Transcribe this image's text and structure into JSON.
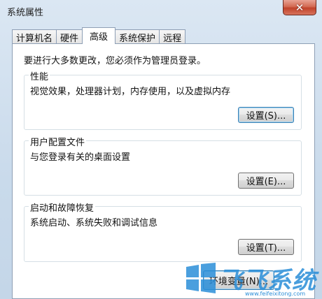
{
  "window": {
    "title": "系统属性",
    "close_glyph": "✕"
  },
  "tabs": [
    {
      "label": "计算机名",
      "active": false
    },
    {
      "label": "硬件",
      "active": false
    },
    {
      "label": "高级",
      "active": true
    },
    {
      "label": "系统保护",
      "active": false
    },
    {
      "label": "远程",
      "active": false
    }
  ],
  "advanced": {
    "admin_note": "要进行大多数更改，您必须作为管理员登录。",
    "performance": {
      "legend": "性能",
      "description": "视觉效果，处理器计划，内存使用，以及虚拟内存",
      "button": "设置(S)..."
    },
    "user_profiles": {
      "legend": "用户配置文件",
      "description": "与您登录有关的桌面设置",
      "button": "设置(E)..."
    },
    "startup_recovery": {
      "legend": "启动和故障恢复",
      "description": "系统启动、系统失败和调试信息",
      "button": "设置(T)..."
    },
    "env_button": "环境变量(N)..."
  },
  "watermark": {
    "brand": "飞飞系统",
    "url": "www.feifeixitong.com"
  }
}
